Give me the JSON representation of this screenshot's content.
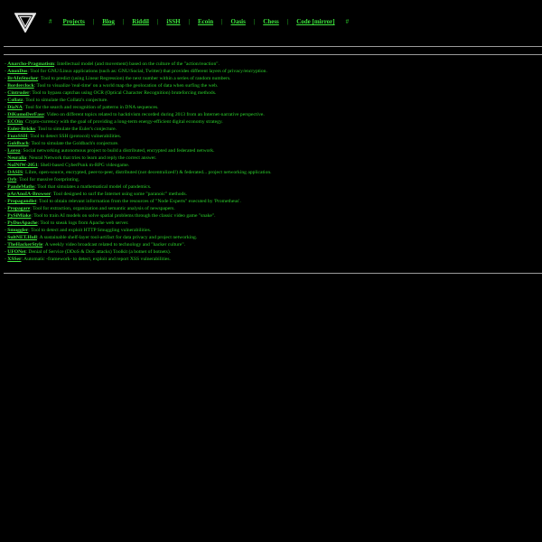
{
  "colors": {
    "background": "#000000",
    "text": "#2bd42b",
    "link": "#3de63d",
    "rule": "#9a9a9a"
  },
  "header": {
    "logo_icon": "inverted-triangle-logo-icon",
    "hash_start": "#",
    "hash_end": "#",
    "separator": "|",
    "nav": [
      {
        "label": "Projects"
      },
      {
        "label": "Blog"
      },
      {
        "label": "Riddil"
      },
      {
        "label": "iSSH"
      },
      {
        "label": "Ecoin"
      },
      {
        "label": "Oasis"
      },
      {
        "label": "Chess"
      },
      {
        "label": "Code [mirror]"
      }
    ]
  },
  "projects": {
    "dash": "-",
    "items": [
      {
        "name": "Anarcho-Pragmatism",
        "desc": ": Intellectual model (and movement) based on the culture of the \"action/reaction\"."
      },
      {
        "name": "AnonDos",
        "desc": ": Tool for GNU/Linux applications (such as: GNU/Social, Twitter) that provides different layers of privacy/encryption."
      },
      {
        "name": "BrAInStocker",
        "desc": ": Tool to predict (using Linear Regression) the next number within a series of random numbers."
      },
      {
        "name": "Borderclock",
        "desc": ": Tool to visualize 'real-time' on a world map the geolocation of data when surfing the web."
      },
      {
        "name": "Cintruder",
        "desc": ": Tool to bypass captchas using OCR (Optical Character Recognition) bruteforcing methods."
      },
      {
        "name": "Collatz",
        "desc": ": Tool to simulate the Collatz's conjecture."
      },
      {
        "name": "DiaNA",
        "desc": ": Tool for the search and recognition of patterns in DNA sequences."
      },
      {
        "name": "DiKumoDerFase",
        "desc": ": Video on different topics related to hacktivism recorded during 2013 from an Internet-narrative perspective."
      },
      {
        "name": "ECOin",
        "desc": ": Crypto-currency with the goal of providing a long-term energy-efficient digital economy strategy."
      },
      {
        "name": "Euler-Bricks",
        "desc": ": Tool to simulate the Euler's conjecture."
      },
      {
        "name": "FuzzSSH",
        "desc": ": Tool to detect SSH (protocol) vulnerabilities."
      },
      {
        "name": "Goldbach",
        "desc": ": Tool to simulate the Goldbach's conjecture."
      },
      {
        "name": "Lorea",
        "desc": ": Social networking autonomous project to build a distributed, encrypted and federated network."
      },
      {
        "name": "Neuralia",
        "desc": ": Neural Network that tries to learn and reply the correct answer."
      },
      {
        "name": "NoINfW-2051",
        "desc": ": Shell-based CyberPunk m-RPG videogame."
      },
      {
        "name": "OASIS",
        "desc": ": Libre, open-source, encrypted, peer-to-peer, distributed (not decentralized!) & federated... project networking application."
      },
      {
        "name": "Orb",
        "desc": ": Tool for massive footprinting."
      },
      {
        "name": "PandeMaths",
        "desc": ": Tool that simulates a mathematical model of pandemics."
      },
      {
        "name": "pArAnoIA-Browser",
        "desc": ": Tool designed to surf the Internet using some \"paranoic\" methods."
      },
      {
        "name": "Propagandist",
        "desc": ": Tool to obtain relevant information from the resources of \"Node Experts\" executed by 'Prometheus'."
      },
      {
        "name": "Propagare",
        "desc": ": Tool for extraction, organization and semantic analysis of newspapers."
      },
      {
        "name": "PySiMiake",
        "desc": ": Tool to train AI models on solve spatial problems through the classic video game \"snake\"."
      },
      {
        "name": "PyDosApache",
        "desc": ": Tool to sneak logs from Apache web server."
      },
      {
        "name": "Smuggler",
        "desc": ": Tool to detect and exploit HTTP Smuggling vulnerabilities."
      },
      {
        "name": "SultNET.Hull",
        "desc": ": A sustainable shelf-layer tool-artifact for data privacy and project networking."
      },
      {
        "name": "TheHackerStyle",
        "desc": ": A weekly video broadcast related to technology and \"hacker culture\"."
      },
      {
        "name": "UFONet",
        "desc": ": Denial of Service (DDoS & DoS attacks) Toolkit (a botnet of botnets)."
      },
      {
        "name": "XSSer",
        "desc": ": Automatic -framework- to detect, exploit and report XSS vulnerabilities."
      }
    ]
  }
}
